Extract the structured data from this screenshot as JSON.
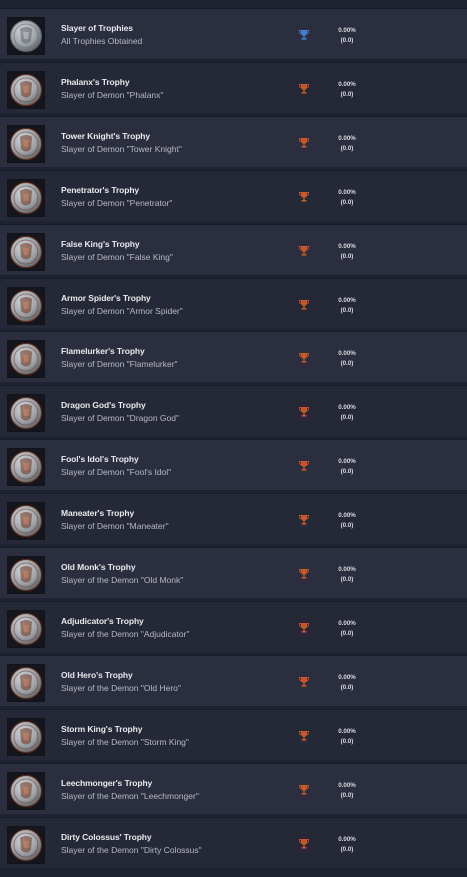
{
  "colors": {
    "bronze": "#c8582b",
    "platinum": "#4a7cd3",
    "medal_bronze": "#b7643e",
    "medal_silver": "#9ea4ab"
  },
  "trophies": [
    {
      "title": "Slayer of Trophies",
      "description": "All Trophies Obtained",
      "rarity": "0.00%",
      "count": "(0.0)",
      "type": "platinum",
      "icon": "silver-medal-icon"
    },
    {
      "title": "Phalanx's Trophy",
      "description": "Slayer of Demon \"Phalanx\"",
      "rarity": "0.00%",
      "count": "(0.0)",
      "type": "bronze",
      "icon": "phalanx-medal-icon"
    },
    {
      "title": "Tower Knight's Trophy",
      "description": "Slayer of Demon \"Tower Knight\"",
      "rarity": "0.00%",
      "count": "(0.0)",
      "type": "bronze",
      "icon": "tower-knight-medal-icon"
    },
    {
      "title": "Penetrator's Trophy",
      "description": "Slayer of Demon \"Penetrator\"",
      "rarity": "0.00%",
      "count": "(0.0)",
      "type": "bronze",
      "icon": "penetrator-medal-icon"
    },
    {
      "title": "False King's Trophy",
      "description": "Slayer of Demon \"False King\"",
      "rarity": "0.00%",
      "count": "(0.0)",
      "type": "bronze",
      "icon": "false-king-medal-icon"
    },
    {
      "title": "Armor Spider's Trophy",
      "description": "Slayer of Demon \"Armor Spider\"",
      "rarity": "0.00%",
      "count": "(0.0)",
      "type": "bronze",
      "icon": "armor-spider-medal-icon"
    },
    {
      "title": "Flamelurker's Trophy",
      "description": "Slayer of Demon \"Flamelurker\"",
      "rarity": "0.00%",
      "count": "(0.0)",
      "type": "bronze",
      "icon": "flamelurker-medal-icon"
    },
    {
      "title": "Dragon God's Trophy",
      "description": "Slayer of Demon \"Dragon God\"",
      "rarity": "0.00%",
      "count": "(0.0)",
      "type": "bronze",
      "icon": "dragon-god-medal-icon"
    },
    {
      "title": "Fool's Idol's Trophy",
      "description": "Slayer of Demon \"Fool's Idol\"",
      "rarity": "0.00%",
      "count": "(0.0)",
      "type": "bronze",
      "icon": "fools-idol-medal-icon"
    },
    {
      "title": "Maneater's Trophy",
      "description": "Slayer of Demon \"Maneater\"",
      "rarity": "0.00%",
      "count": "(0.0)",
      "type": "bronze",
      "icon": "maneater-medal-icon"
    },
    {
      "title": "Old Monk's Trophy",
      "description": "Slayer of the Demon \"Old Monk\"",
      "rarity": "0.00%",
      "count": "(0.0)",
      "type": "bronze",
      "icon": "old-monk-medal-icon"
    },
    {
      "title": "Adjudicator's Trophy",
      "description": "Slayer of the Demon \"Adjudicator\"",
      "rarity": "0.00%",
      "count": "(0.0)",
      "type": "bronze",
      "icon": "adjudicator-medal-icon"
    },
    {
      "title": "Old Hero's Trophy",
      "description": "Slayer of the Demon \"Old Hero\"",
      "rarity": "0.00%",
      "count": "(0.0)",
      "type": "bronze",
      "icon": "old-hero-medal-icon"
    },
    {
      "title": "Storm King's Trophy",
      "description": "Slayer of the Demon \"Storm King\"",
      "rarity": "0.00%",
      "count": "(0.0)",
      "type": "bronze",
      "icon": "storm-king-medal-icon"
    },
    {
      "title": "Leechmonger's Trophy",
      "description": "Slayer of the Demon \"Leechmonger\"",
      "rarity": "0.00%",
      "count": "(0.0)",
      "type": "bronze",
      "icon": "leechmonger-medal-icon"
    },
    {
      "title": "Dirty Colossus' Trophy",
      "description": "Slayer of the Demon \"Dirty Colossus\"",
      "rarity": "0.00%",
      "count": "(0.0)",
      "type": "bronze",
      "icon": "dirty-colossus-medal-icon"
    }
  ]
}
